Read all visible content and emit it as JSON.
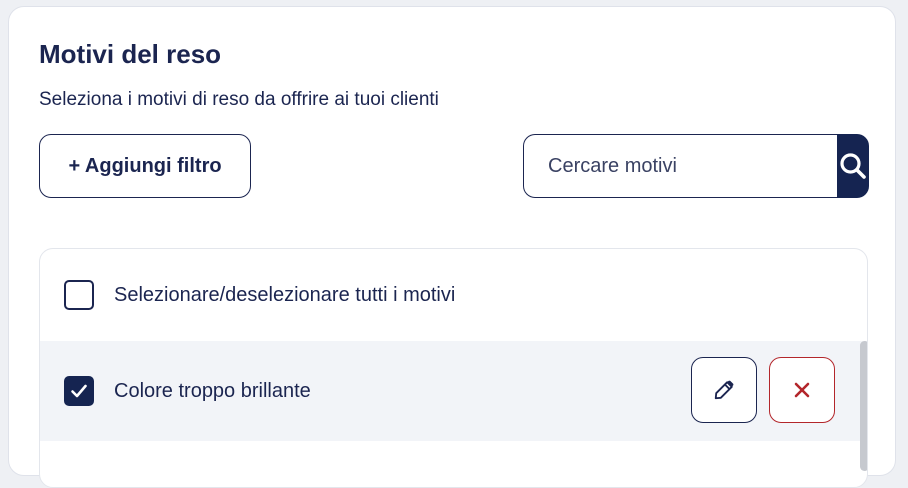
{
  "header": {
    "title": "Motivi del reso",
    "subtitle": "Seleziona i motivi di reso da offrire ai tuoi clienti"
  },
  "toolbar": {
    "add_filter_label": "+ Aggiungi filtro",
    "search": {
      "placeholder": "Cercare motivi",
      "value": ""
    }
  },
  "list": {
    "select_all": {
      "label": "Selezionare/deselezionare tutti i motivi",
      "checked": false
    },
    "items": [
      {
        "label": "Colore troppo brillante",
        "checked": true
      }
    ]
  },
  "icons": {
    "search": "search-icon",
    "edit": "pencil-icon",
    "delete": "close-icon",
    "check": "checkmark-icon"
  },
  "colors": {
    "primary": "#152451",
    "text": "#1b2550",
    "danger": "#b3262b",
    "row_highlight": "#f2f4f8"
  }
}
